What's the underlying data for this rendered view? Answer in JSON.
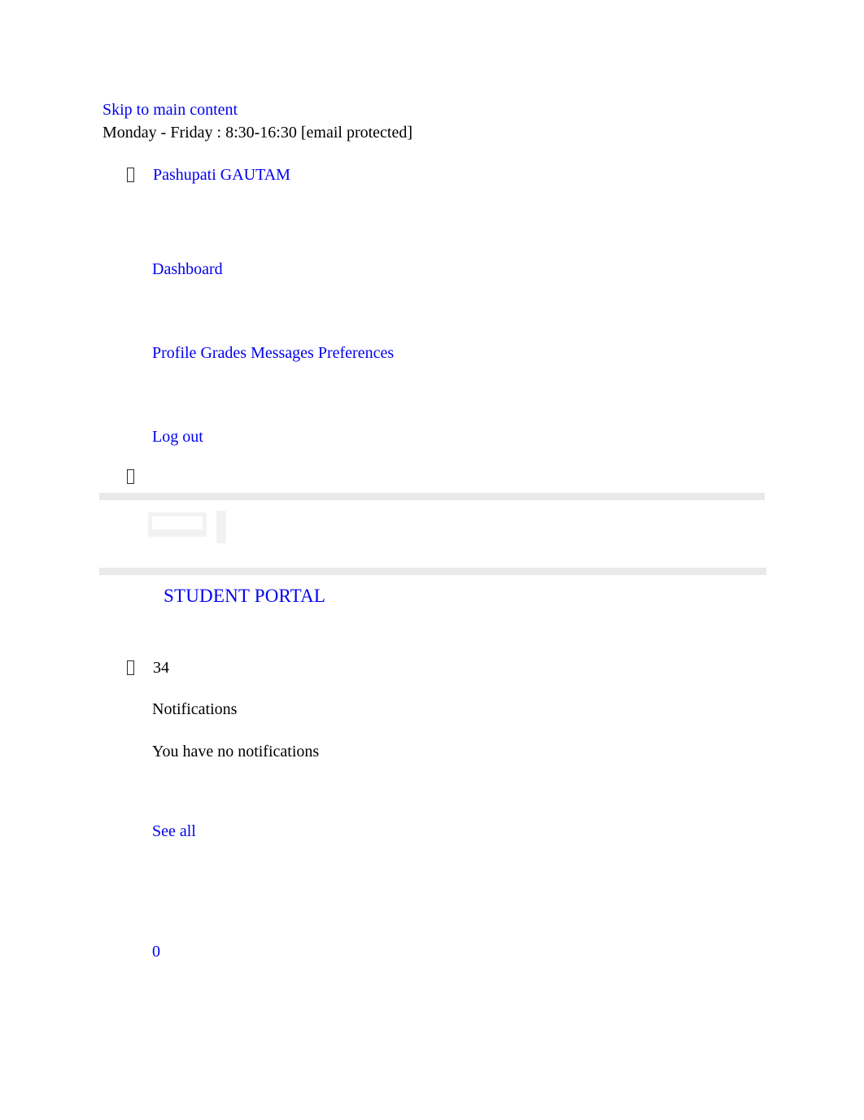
{
  "page": {
    "skip_link": "Skip to main content",
    "hours_line": "Monday - Friday : 8:30-16:30 [email protected]",
    "portal_title": "STUDENT PORTAL",
    "link_color": "#0000ee",
    "text_color": "#000000",
    "rule_color": "#e9e9e9"
  },
  "account": {
    "user_icon": "user-icon",
    "user_name": "Pashupati GAUTAM",
    "dashboard_label": "Dashboard",
    "logout_label": "Log out",
    "menu_icon": "menu-icon",
    "nav": [
      {
        "label": "Profile"
      },
      {
        "label": "Grades"
      },
      {
        "label": "Messages"
      },
      {
        "label": "Preferences"
      }
    ]
  },
  "brand": {
    "logo_alt": "broken-image-icon"
  },
  "notifications": {
    "bell_icon": "bell-icon",
    "count": "34",
    "heading": "Notifications",
    "empty_message": "You have no notifications",
    "see_all_label": "See all",
    "messages_count": "0"
  }
}
